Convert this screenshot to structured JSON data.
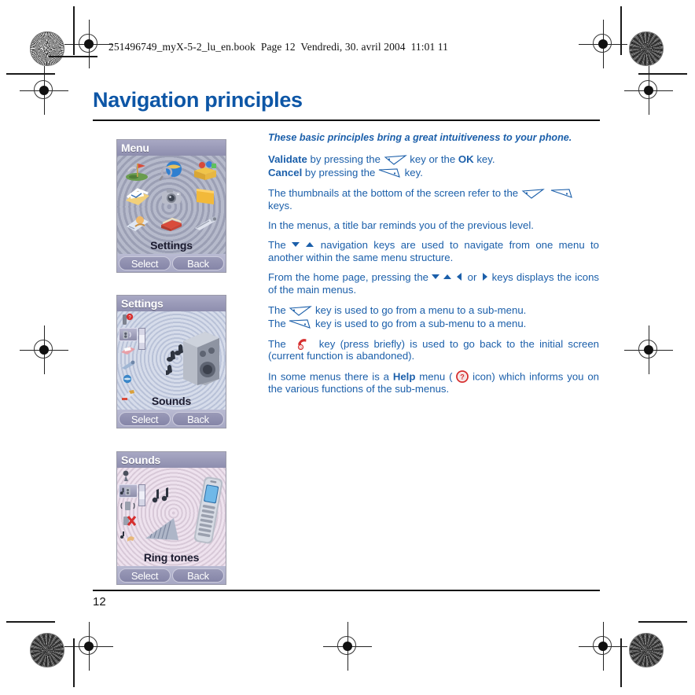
{
  "document": {
    "file_info": "251496749_myX-5-2_lu_en.book  Page 12  Vendredi, 30. avril 2004  11:01 11",
    "page_title": "Navigation principles",
    "page_number": "12",
    "title_color": "#0d56a6",
    "body_color": "#1b5faa"
  },
  "body": {
    "lead": "These basic principles bring a great intuitiveness to your phone.",
    "validate": {
      "bold_lead": "Validate",
      "text_before_key": " by pressing the ",
      "text_after_key": " key or the ",
      "ok_label": "OK",
      "text_end": " key."
    },
    "cancel": {
      "bold_lead": "Cancel",
      "text_before_key": " by pressing the ",
      "text_end": " key."
    },
    "thumbnails": {
      "before": "The thumbnails at the bottom of the screen refer to the ",
      "after": "keys."
    },
    "titlebar_note": "In the menus, a title bar reminds you of the previous level.",
    "nav_keys": {
      "before": "The ",
      "after": " navigation keys are used to navigate from one menu to another within the same menu structure."
    },
    "home_page": {
      "before": "From the home page, pressing the ",
      "middle": " or ",
      "after": " keys displays the icons of the main menus."
    },
    "left_soft": {
      "before": "The ",
      "after": " key  is used to go from a menu to a sub-menu."
    },
    "right_soft": {
      "before": "The ",
      "after": " key is used to go from a sub-menu to a menu."
    },
    "hangup": {
      "before": "The ",
      "after": " key (press briefly) is used to go back to the initial screen (current function is abandoned)."
    },
    "help": {
      "before": "In some menus there is a ",
      "bold": "Help",
      "middle": " menu ( ",
      "after": " icon) which informs you on the various functions of the sub-menus."
    }
  },
  "screenshots": [
    {
      "title": "Menu",
      "caption": "Settings",
      "left_softkey": "Select",
      "right_softkey": "Back",
      "icons": [
        "games-icon",
        "browser-icon",
        "toolbox-icon",
        "messages-icon",
        "camera-icon",
        "folder-icon",
        "contacts-icon",
        "organiser-icon",
        "settings-icon"
      ]
    },
    {
      "title": "Settings",
      "caption": "Sounds",
      "left_softkey": "Select",
      "right_softkey": "Back",
      "sidebar_icons": [
        "help-icon",
        "sounds-icon",
        "display-icon",
        "keys-icon",
        "network-icon",
        "security-icon"
      ],
      "hero": "speaker-icon"
    },
    {
      "title": "Sounds",
      "caption": "Ring tones",
      "left_softkey": "Select",
      "right_softkey": "Back",
      "sidebar_icons": [
        "volume-icon",
        "ringtones-icon",
        "vibrate-icon",
        "silent-icon",
        "alerts-icon"
      ],
      "hero": "mobile-phone-icon"
    }
  ],
  "icons": {
    "left_soft_key": "left-soft-key-icon",
    "right_soft_key": "right-soft-key-icon",
    "hangup_key": "red-hangup-key-icon",
    "help": "help-question-icon"
  }
}
